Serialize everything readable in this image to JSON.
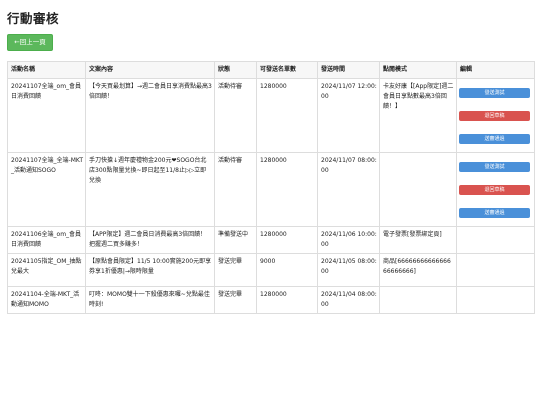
{
  "page": {
    "title": "行動審核",
    "back_label": "←回上一頁"
  },
  "table": {
    "headers": [
      "活動名稱",
      "文案內容",
      "狀態",
      "可發送名單數",
      "發送時間",
      "點閱模式",
      "編輯"
    ],
    "rows": [
      {
        "name": "20241107全端_om_會員日消費回饋",
        "content": "【今天買最划算】→週二會員日享消費點最高3倍回饋！",
        "status": "活動待審",
        "count": "1280000",
        "time": "2024/11/07 12:00:00",
        "mode": "卡友好康【[App限定]週二會員日享點數最高3倍回饋！】",
        "actions": [
          "發送測試",
          "退回草稿",
          "送審通過"
        ]
      },
      {
        "name": "20241107全端_全端-MKT_活動通知SOGO",
        "content": "手刀快搶↓週年慶禮物金200元❤SOGO台北店300點限量兌換~即日起至11/8止▷▷立即兌換",
        "status": "活動待審",
        "count": "1280000",
        "time": "2024/11/07 08:00:00",
        "mode": "",
        "actions": [
          "發送測試",
          "退回草稿",
          "送審通過"
        ]
      },
      {
        "name": "20241106全端_om_會員日消費回饋",
        "content": "【APP限定】週二會員日消費最高3倍回饋！把握週二買多賺多！",
        "status": "準備發送中",
        "count": "1280000",
        "time": "2024/11/06 10:00:00",
        "mode": "電子發票[發票綁定頁]",
        "actions": []
      },
      {
        "name": "20241105指定_OM_抽點兌最大",
        "content": "【原點會員限定】11/5 10:00實施200元即享券享1折優惠|→限時限量",
        "status": "發送完畢",
        "count": "9000",
        "time": "2024/11/05 08:00:00",
        "mode": "商品[6666666666666666666666]",
        "actions": []
      },
      {
        "name": "20241104-全端-MKT_活動通知MOMO",
        "content": "叮咚：MOMO雙十一下殺優惠來囉~兌點最佳時刻!",
        "status": "發送完畢",
        "count": "1280000",
        "time": "2024/11/04 08:00:00",
        "mode": "",
        "actions": []
      }
    ]
  },
  "colors": {
    "back_button": "#5cb85c",
    "action_blue": "#4a90d9",
    "action_red": "#d9534f",
    "header_bg": "#f7f7f7",
    "border": "#dddddd"
  }
}
